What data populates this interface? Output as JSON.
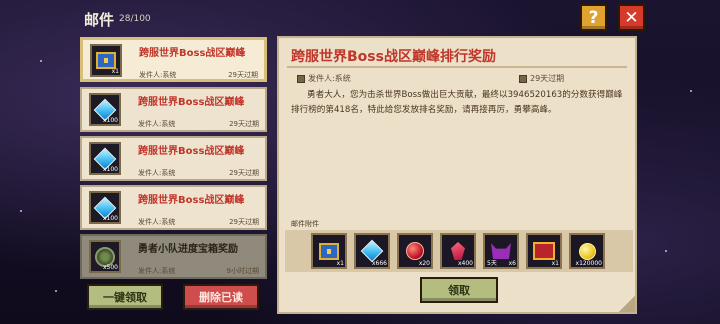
{
  "header": {
    "title": "邮件",
    "count": "28/100",
    "help_label": "?",
    "close_label": "✕"
  },
  "mail_list": [
    {
      "title": "跨服世界Boss战区巅峰",
      "sender": "发件人:系统",
      "expire": "29天过期",
      "icon": "chest-icon",
      "qty": "x1"
    },
    {
      "title": "跨服世界Boss战区巅峰",
      "sender": "发件人:系统",
      "expire": "29天过期",
      "icon": "diamond-icon",
      "qty": "x100"
    },
    {
      "title": "跨服世界Boss战区巅峰",
      "sender": "发件人:系统",
      "expire": "29天过期",
      "icon": "diamond-icon",
      "qty": "x100"
    },
    {
      "title": "跨服世界Boss战区巅峰",
      "sender": "发件人:系统",
      "expire": "29天过期",
      "icon": "diamond-icon",
      "qty": "x100"
    },
    {
      "title": "勇者小队进度宝箱奖励",
      "sender": "发件人:系统",
      "expire": "9小时过期",
      "icon": "medal-icon",
      "qty": "x500"
    }
  ],
  "actions": {
    "claim_all": "一键领取",
    "delete_read": "删除已读"
  },
  "detail": {
    "title": "跨服世界Boss战区巅峰排行奖励",
    "sender": "发件人:系统",
    "expire": "29天过期",
    "body": "勇者大人，您为击杀世界Boss做出巨大贡献，最终以3946520163的分数获得巅峰排行榜的第418名，特此给您发放排名奖励，请再接再厉，勇攀高峰。",
    "attachments_label": "邮件附件",
    "attachments": [
      {
        "icon": "chest-icon",
        "qty": "x1"
      },
      {
        "icon": "diamond-icon",
        "qty": "x666"
      },
      {
        "icon": "red-orb-icon",
        "qty": "x20"
      },
      {
        "icon": "red-gem-icon",
        "qty": "x400"
      },
      {
        "icon": "demon-icon",
        "qty": "x6",
        "tag": "5天"
      },
      {
        "icon": "red-chest-icon",
        "qty": "x1"
      },
      {
        "icon": "gold-coin-icon",
        "qty": "x120000"
      }
    ],
    "receive_label": "领取"
  }
}
